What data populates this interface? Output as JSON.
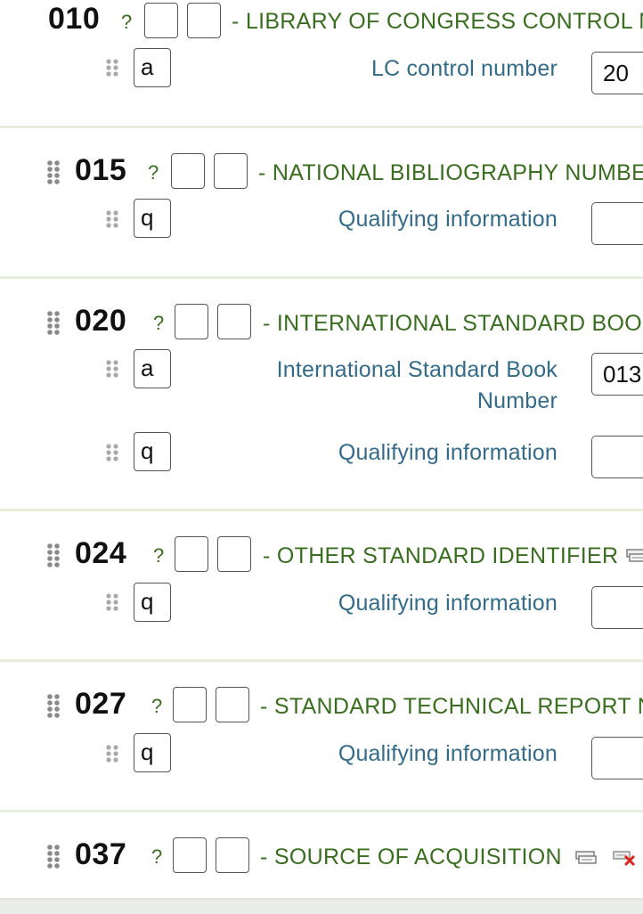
{
  "fields": [
    {
      "tag": "010",
      "help": "?",
      "title": "- LIBRARY OF CONGRESS CONTROL N",
      "subfields": [
        {
          "code": "a",
          "label": "LC control number",
          "value": "20"
        }
      ]
    },
    {
      "tag": "015",
      "help": "?",
      "title": "- NATIONAL BIBLIOGRAPHY NUMBE",
      "subfields": [
        {
          "code": "q",
          "label": "Qualifying information",
          "value": ""
        }
      ]
    },
    {
      "tag": "020",
      "help": "?",
      "title": "- INTERNATIONAL STANDARD BOO",
      "subfields": [
        {
          "code": "a",
          "label_line1": "International Standard Book",
          "label_line2": "Number",
          "value": "013"
        },
        {
          "code": "q",
          "label": "Qualifying information",
          "value": ""
        }
      ]
    },
    {
      "tag": "024",
      "help": "?",
      "title": "- OTHER STANDARD IDENTIFIER",
      "icons": [
        "clone-field-icon"
      ],
      "subfields": [
        {
          "code": "q",
          "label": "Qualifying information",
          "value": ""
        }
      ]
    },
    {
      "tag": "027",
      "help": "?",
      "title": "- STANDARD TECHNICAL REPORT N",
      "subfields": [
        {
          "code": "q",
          "label": "Qualifying information",
          "value": ""
        }
      ]
    },
    {
      "tag": "037",
      "help": "?",
      "title": "- SOURCE OF ACQUISITION",
      "icons": [
        "clone-field-icon",
        "delete-field-icon"
      ]
    }
  ],
  "colors": {
    "title_green": "#3a6e1f",
    "label_blue": "#336b8a",
    "separator": "#e6efdc",
    "delete_red": "#d9261c"
  }
}
